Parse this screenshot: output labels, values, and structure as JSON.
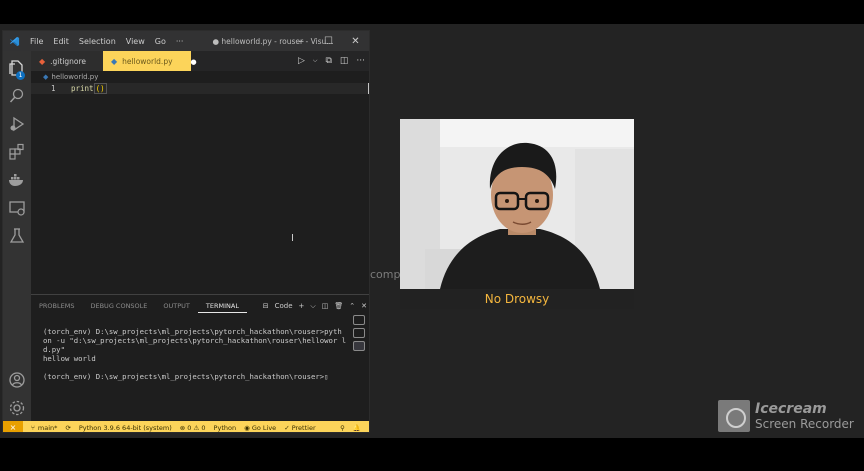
{
  "titlebar": {
    "menus": [
      "File",
      "Edit",
      "Selection",
      "View",
      "Go",
      "···"
    ],
    "title": "● helloworld.py - rouser - Visu..."
  },
  "activity": {
    "explorer_badge": "1"
  },
  "tabs": [
    {
      "label": ".gitignore"
    },
    {
      "label": "helloworld.py",
      "modified_dot": "●"
    }
  ],
  "breadcrumb": {
    "file": "helloworld.py"
  },
  "editor": {
    "lines": [
      {
        "number": "1",
        "text": "print",
        "parens": "()"
      }
    ]
  },
  "panel": {
    "tabs": [
      "PROBLEMS",
      "DEBUG CONSOLE",
      "OUTPUT",
      "TERMINAL"
    ],
    "active_tab": "TERMINAL",
    "terminal_selector": "Code",
    "terminal_output": "(torch_env) D:\\sw_projects\\ml_projects\\pytorch_hackathon\\rouser>pyth\non -u \"d:\\sw_projects\\ml_projects\\pytorch_hackathon\\rouser\\hellowor l\nd.py\"\nhellow world\n\n(torch_env) D:\\sw_projects\\ml_projects\\pytorch_hackathon\\rouser>▯"
  },
  "statusbar": {
    "branch": "main*",
    "interpreter": "Python 3.9.6 64-bit (system)",
    "problems": "⊗ 0 ⚠ 0",
    "language": "Python",
    "golive": "Go Live",
    "prettier": "Prettier"
  },
  "background_text": "comp",
  "webcam": {
    "status_label": "No Drowsy"
  },
  "watermark": {
    "line1": "Icecream",
    "line2": "Screen Recorder"
  },
  "colors": {
    "status_yellow": "#fcd45a",
    "label_orange": "#f4b63e"
  }
}
